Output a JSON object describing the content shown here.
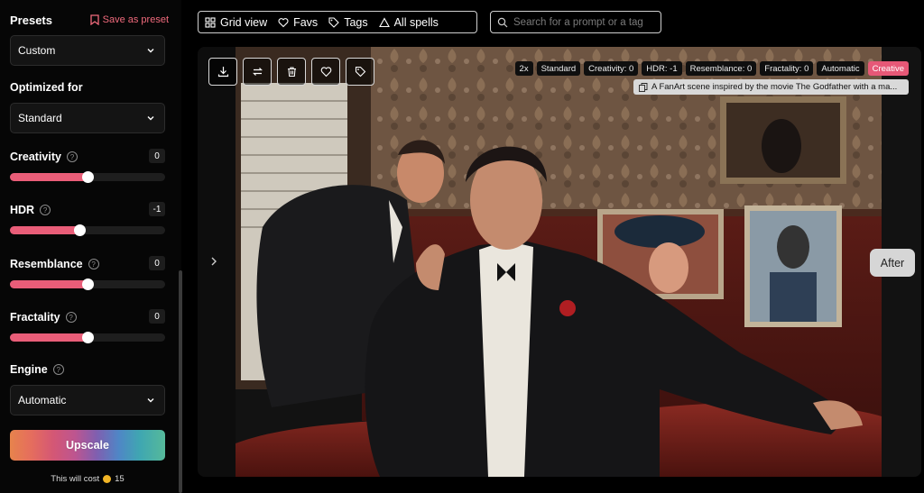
{
  "sidebar": {
    "presets_title": "Presets",
    "save_preset_label": "Save as preset",
    "preset_value": "Custom",
    "optimized_title": "Optimized for",
    "optimized_value": "Standard",
    "sliders": [
      {
        "label": "Creativity",
        "value": "0",
        "level": 0.5
      },
      {
        "label": "HDR",
        "value": "-1",
        "level": 0.45
      },
      {
        "label": "Resemblance",
        "value": "0",
        "level": 0.5
      },
      {
        "label": "Fractality",
        "value": "0",
        "level": 0.5
      }
    ],
    "engine_title": "Engine",
    "engine_value": "Automatic",
    "upscale_label": "Upscale",
    "cost_label": "This will cost",
    "cost_value": "15",
    "accent_color": "#e95d78"
  },
  "toolbar": {
    "grid_label": "Grid view",
    "favs_label": "Favs",
    "tags_label": "Tags",
    "spells_label": "All spells"
  },
  "search": {
    "placeholder": "Search for a prompt or a tag"
  },
  "viewer": {
    "tags": [
      "2x",
      "Standard",
      "Creativity: 0",
      "HDR: -1",
      "Resemblance: 0",
      "Fractality: 0",
      "Automatic",
      "Creative"
    ],
    "prompt": "A FanArt scene inspired by the movie The Godfather with a ma...",
    "after_label": "After",
    "icons": [
      "download-icon",
      "swap-icon",
      "trash-icon",
      "heart-icon",
      "tag-icon"
    ]
  }
}
